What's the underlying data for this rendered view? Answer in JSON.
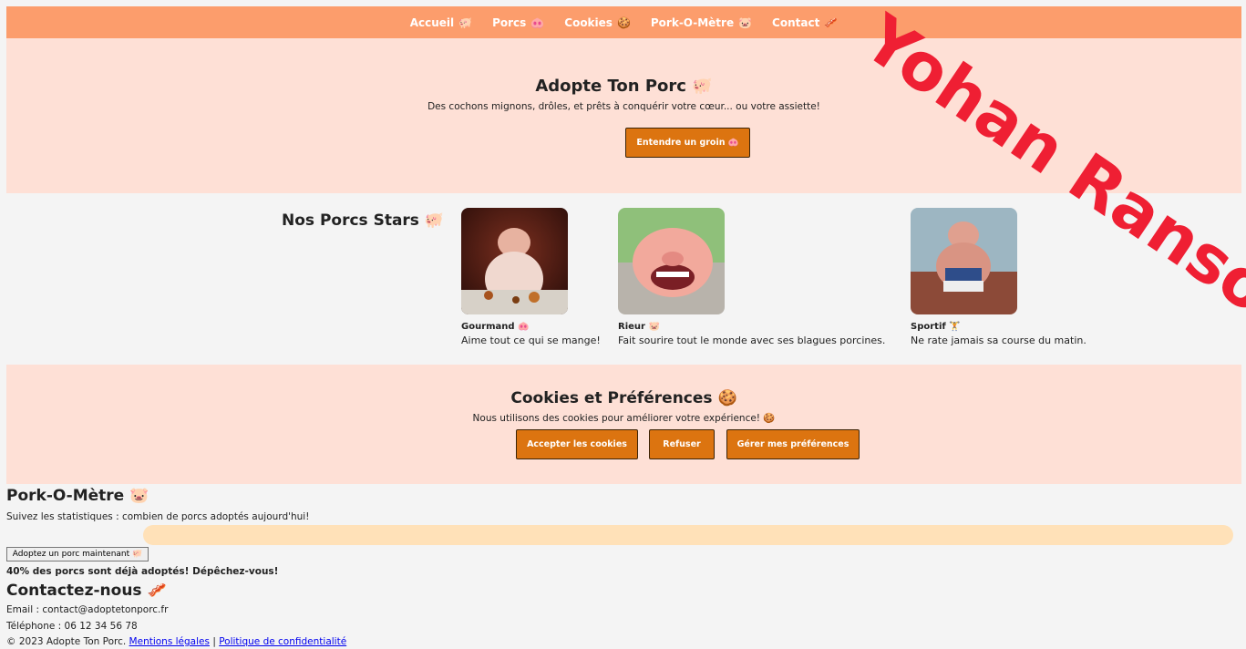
{
  "nav": [
    {
      "label": "Accueil",
      "icon": "🐖"
    },
    {
      "label": "Porcs",
      "icon": "🐽"
    },
    {
      "label": "Cookies",
      "icon": "🍪"
    },
    {
      "label": "Pork-O-Mètre",
      "icon": "🐷"
    },
    {
      "label": "Contact",
      "icon": "🥓"
    }
  ],
  "hero": {
    "title": "Adopte Ton Porc 🐖",
    "subtitle": "Des cochons mignons, drôles, et prêts à conquérir votre cœur... ou votre assiette!",
    "button": "Entendre un groin 🐽"
  },
  "stars": {
    "title": "Nos Porcs Stars 🐖",
    "cards": [
      {
        "name": "Gourmand 🐽",
        "description": "Aime tout ce qui se mange!"
      },
      {
        "name": "Rieur 🐷",
        "description": "Fait sourire tout le monde avec ses blagues porcines."
      },
      {
        "name": "Sportif 🏋",
        "description": "Ne rate jamais sa course du matin."
      }
    ]
  },
  "cookies": {
    "title": "Cookies et Préférences 🍪",
    "text": "Nous utilisons des cookies pour améliorer votre expérience! 🍪",
    "buttons": [
      "Accepter les cookies",
      "Refuser",
      "Gérer mes préférences"
    ]
  },
  "porkometre": {
    "title": "Pork-O-Mètre 🐷",
    "subtitle": "Suivez les statistiques : combien de porcs adoptés aujourd'hui!",
    "progress": 0,
    "button": "Adoptez un porc maintenant 🐖",
    "message": "40% des porcs sont déjà adoptés! Dépêchez-vous!"
  },
  "contact": {
    "title": "Contactez-nous 🥓",
    "email": "Email : contact@adoptetonporc.fr",
    "phone": "Téléphone : 06 12 34 56 78"
  },
  "footer": {
    "copyright": "© 2023 Adopte Ton Porc.",
    "legal": "Mentions légales",
    "separator": "|",
    "privacy": "Politique de confidentialité"
  },
  "watermark": "Yohan Ranso",
  "colors": {
    "nav": "#fc9d6c",
    "section": "#fee0d6",
    "button": "#dc7410",
    "watermark": "#ef1f33"
  }
}
